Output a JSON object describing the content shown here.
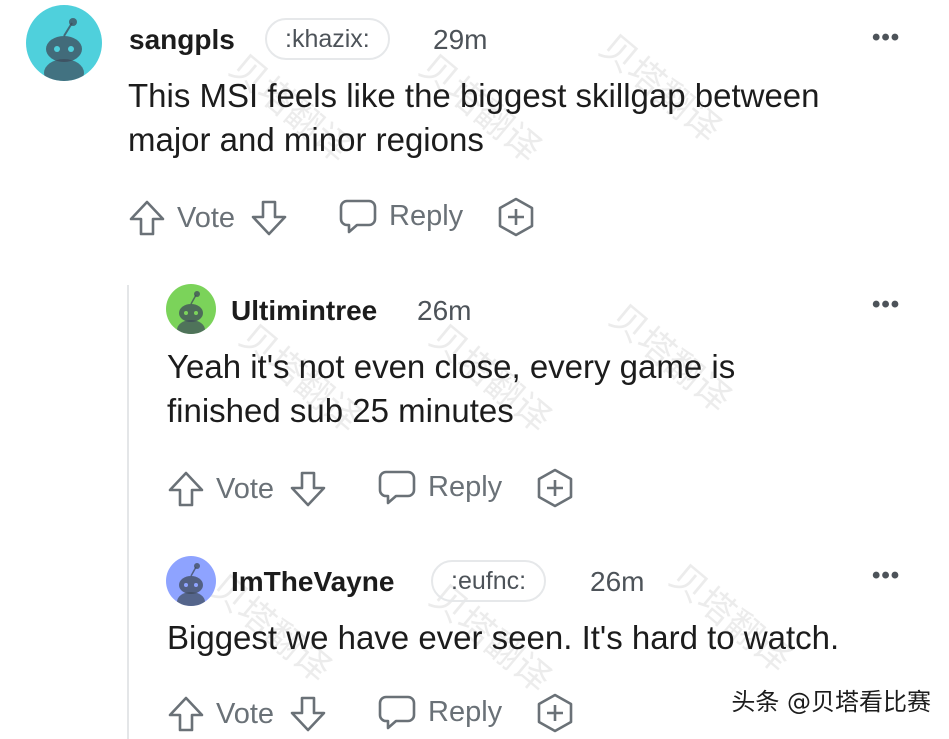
{
  "comments": [
    {
      "username": "sangpls",
      "flair": ":khazix:",
      "time": "29m",
      "text_line1": "This MSI feels like the biggest skillgap between",
      "text_line2": "major and minor regions",
      "avatar_color": "#4fd0dc"
    },
    {
      "username": "Ultimintree",
      "time": "26m",
      "text_line1": "Yeah it's not even close, every game is",
      "text_line2": "finished sub 25 minutes",
      "avatar_color": "#7bd35a"
    },
    {
      "username": "ImTheVayne",
      "flair": ":eufnc:",
      "time": "26m",
      "text_line1": "Biggest we have ever seen. It's hard to watch.",
      "avatar_color": "#8ea3ff"
    }
  ],
  "actions": {
    "vote": "Vote",
    "reply": "Reply"
  },
  "more_glyph": "•••",
  "watermark_text": "贝塔翻译",
  "credit": "头条 @贝塔看比赛"
}
